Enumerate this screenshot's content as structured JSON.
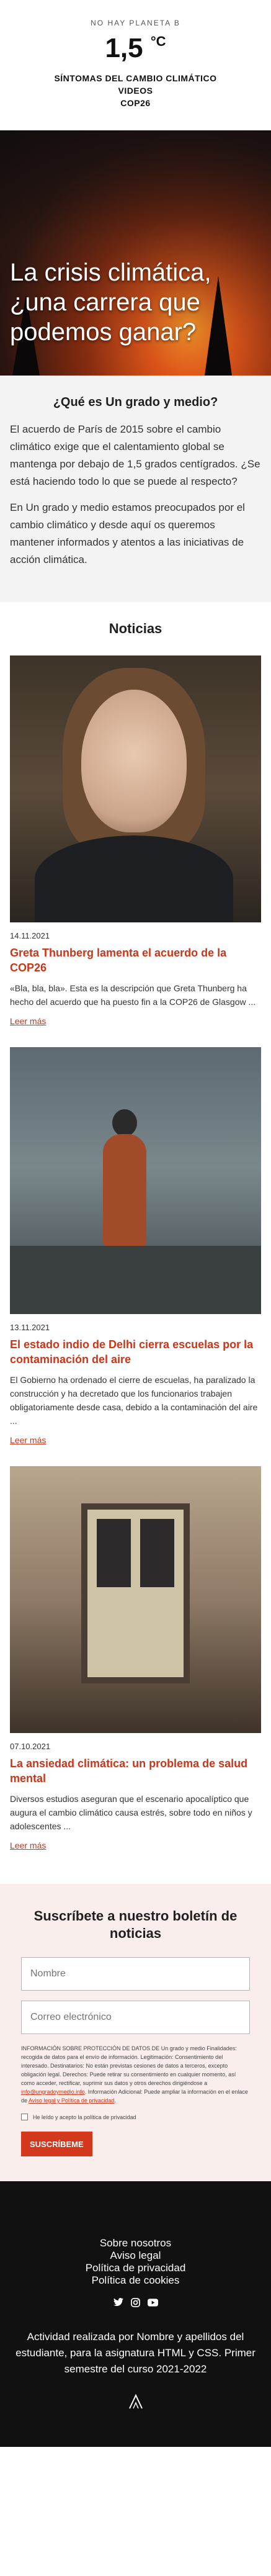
{
  "header": {
    "tagline": "NO HAY PLANETA B",
    "logo_value": "1,5",
    "logo_unit": "°C",
    "nav": [
      "SÍNTOMAS DEL CAMBIO CLIMÁTICO",
      "VIDEOS",
      "COP26"
    ]
  },
  "hero": {
    "title": "La crisis climática, ¿una carrera que podemos ganar?"
  },
  "intro": {
    "heading": "¿Qué es Un grado y medio?",
    "paragraphs": [
      "El acuerdo de París de 2015 sobre el cambio climático exige que el calentamiento global se mantenga por debajo de 1,5 grados centígrados. ¿Se está haciendo todo lo que se puede al respecto?",
      "En Un grado y medio estamos preocupados por el cambio climático y desde aquí os queremos mantener informados y atentos a las iniciativas de acción climática."
    ]
  },
  "news": {
    "title": "Noticias",
    "read_more": "Leer más",
    "items": [
      {
        "date": "14.11.2021",
        "title": "Greta Thunberg lamenta el acuerdo de la COP26",
        "excerpt": "«Bla, bla, bla». Esta es la descripción que Greta Thunberg ha hecho del acuerdo que ha puesto fin a la COP26 de Glasgow ..."
      },
      {
        "date": "13.11.2021",
        "title": "El estado indio de Delhi cierra escuelas por la contaminación del aire",
        "excerpt": "El Gobierno ha ordenado el cierre de escuelas, ha paralizado la construcción y ha decretado que los funcionarios trabajen obligatoriamente desde casa, debido a la contaminación del aire ..."
      },
      {
        "date": "07.10.2021",
        "title": "La ansiedad climática: un problema de salud mental",
        "excerpt": "Diversos estudios aseguran que el escenario apocalíptico que augura el cambio climático causa estrés, sobre todo en niños y adolescentes ..."
      }
    ]
  },
  "newsletter": {
    "title": "Suscríbete a nuestro boletín de noticias",
    "name_placeholder": "Nombre",
    "email_placeholder": "Correo electrónico",
    "legal_text": "INFORMACIÓN SOBRE PROTECCIÓN DE DATOS DE Un grado y medio Finalidades: recogida de datos para el envío de información. Legitimación: Consentimiento del interesado. Destinatarios: No están previstas cesiones de datos a terceros, excepto obligación legal. Derechos: Puede retirar su consentimiento en cualquier momento, así como acceder, rectificar, suprimir sus datos y otros derechos dirigiéndose a",
    "legal_email": "info@ungradoymedio.info",
    "legal_suffix": "Información Adicional: Puede ampliar la información en el enlace de",
    "legal_link": "Aviso legal y Política de privacidad",
    "checkbox_label": "He leído y acepto la política de privacidad",
    "subscribe_label": "SUSCRÍBEME"
  },
  "footer": {
    "links": [
      "Sobre nosotros",
      "Aviso legal",
      "Política de privacidad",
      "Política de cookies"
    ],
    "social": [
      "twitter-icon",
      "instagram-icon",
      "youtube-icon"
    ],
    "credit": "Actividad realizada por Nombre y apellidos del estudiante, para la asignatura HTML y CSS. Primer semestre del curso 2021-2022"
  },
  "colors": {
    "accent": "#c9361a",
    "footer_bg": "#111111",
    "intro_bg": "#f3f3f3",
    "newsletter_bg": "#f9eeeb"
  }
}
